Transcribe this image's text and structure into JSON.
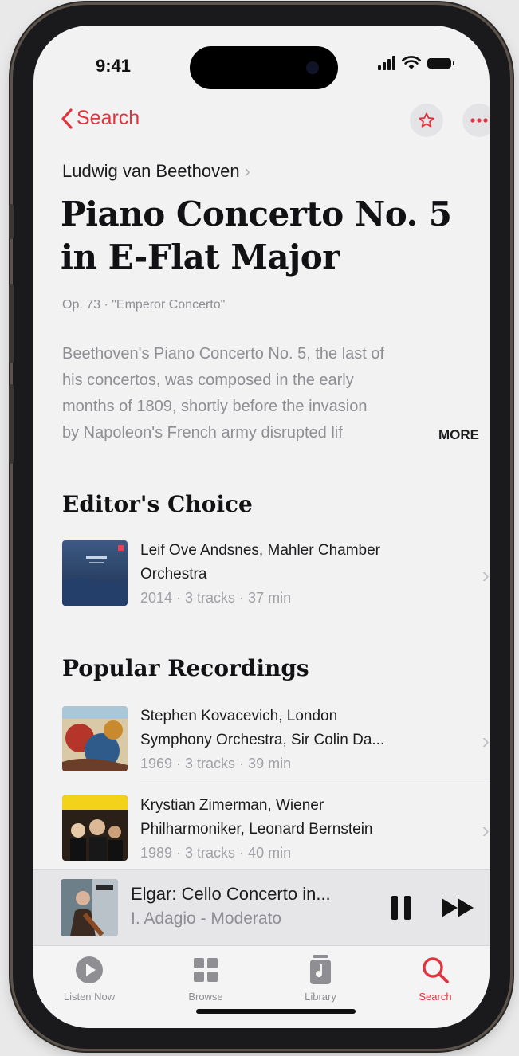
{
  "status": {
    "time": "9:41"
  },
  "nav": {
    "back_label": "Search"
  },
  "work": {
    "composer": "Ludwig van Beethoven",
    "title_line1": "Piano Concerto No. 5",
    "title_line2": "in E-Flat Major",
    "subtitle": "Op. 73 · \"Emperor Concerto\"",
    "description_lines": [
      "Beethoven's Piano Concerto No. 5, the last of",
      "his concertos, was composed in the early",
      "months of 1809, shortly before the invasion",
      "by Napoleon's French army disrupted lif"
    ],
    "more_label": "MORE"
  },
  "editors_choice": {
    "heading": "Editor's Choice",
    "item": {
      "line1": "Leif Ove Andsnes, Mahler Chamber",
      "line2": "Orchestra",
      "meta": "2014 · 3 tracks · 37 min"
    }
  },
  "popular": {
    "heading": "Popular Recordings",
    "items": [
      {
        "line1": "Stephen Kovacevich, London",
        "line2": "Symphony Orchestra, Sir Colin Da...",
        "meta": "1969 · 3 tracks · 39 min"
      },
      {
        "line1": "Krystian Zimerman, Wiener",
        "line2": "Philharmoniker, Leonard Bernstein",
        "meta": "1989 · 3 tracks · 40 min"
      }
    ]
  },
  "now_playing": {
    "title": "Elgar: Cello Concerto in...",
    "subtitle": "I. Adagio - Moderato"
  },
  "tabs": [
    {
      "label": "Listen Now",
      "icon": "play-circle-icon"
    },
    {
      "label": "Browse",
      "icon": "grid-icon"
    },
    {
      "label": "Library",
      "icon": "library-icon"
    },
    {
      "label": "Search",
      "icon": "search-icon",
      "active": true
    }
  ],
  "colors": {
    "accent": "#e0343f",
    "secondary_text": "#8e8e93"
  }
}
